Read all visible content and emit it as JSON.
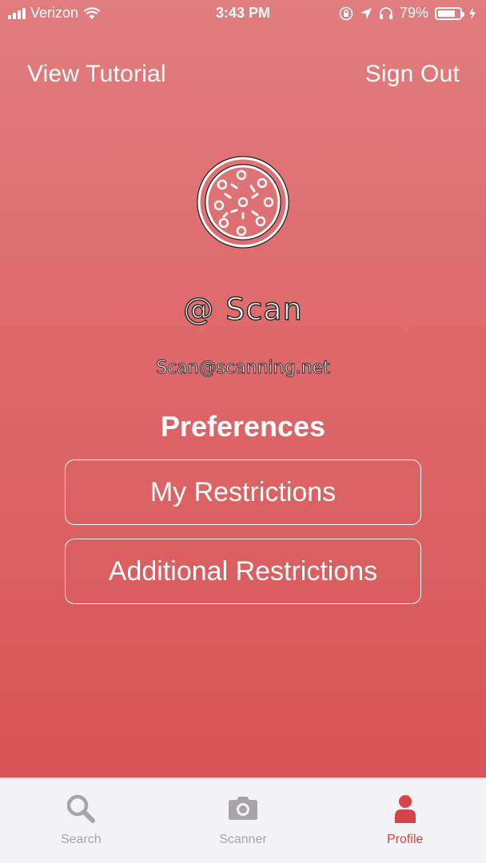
{
  "status_bar": {
    "carrier": "Verizon",
    "time": "3:43 PM",
    "battery": "79%",
    "battery_level": 0.79,
    "icons": [
      "signal-icon",
      "wifi-icon",
      "orientation-lock-icon",
      "location-icon",
      "headphones-icon",
      "battery-icon",
      "charging-icon"
    ]
  },
  "header": {
    "view_tutorial": "View Tutorial",
    "sign_out": "Sign Out"
  },
  "profile": {
    "avatar_icon": "pizza-icon",
    "at_symbol": "@",
    "username": "Scan",
    "email": "Scan@scanning.net"
  },
  "preferences": {
    "title": "Preferences",
    "my_restrictions": "My Restrictions",
    "additional_restrictions": "Additional Restrictions"
  },
  "tabs": [
    {
      "label": "Search",
      "icon": "search-icon",
      "active": false
    },
    {
      "label": "Scanner",
      "icon": "camera-icon",
      "active": false
    },
    {
      "label": "Profile",
      "icon": "person-icon",
      "active": true
    }
  ],
  "colors": {
    "accent": "#d64447",
    "inactive": "#a9a4a8",
    "background_top": "#e07d7e",
    "background_bottom": "#d85153"
  }
}
